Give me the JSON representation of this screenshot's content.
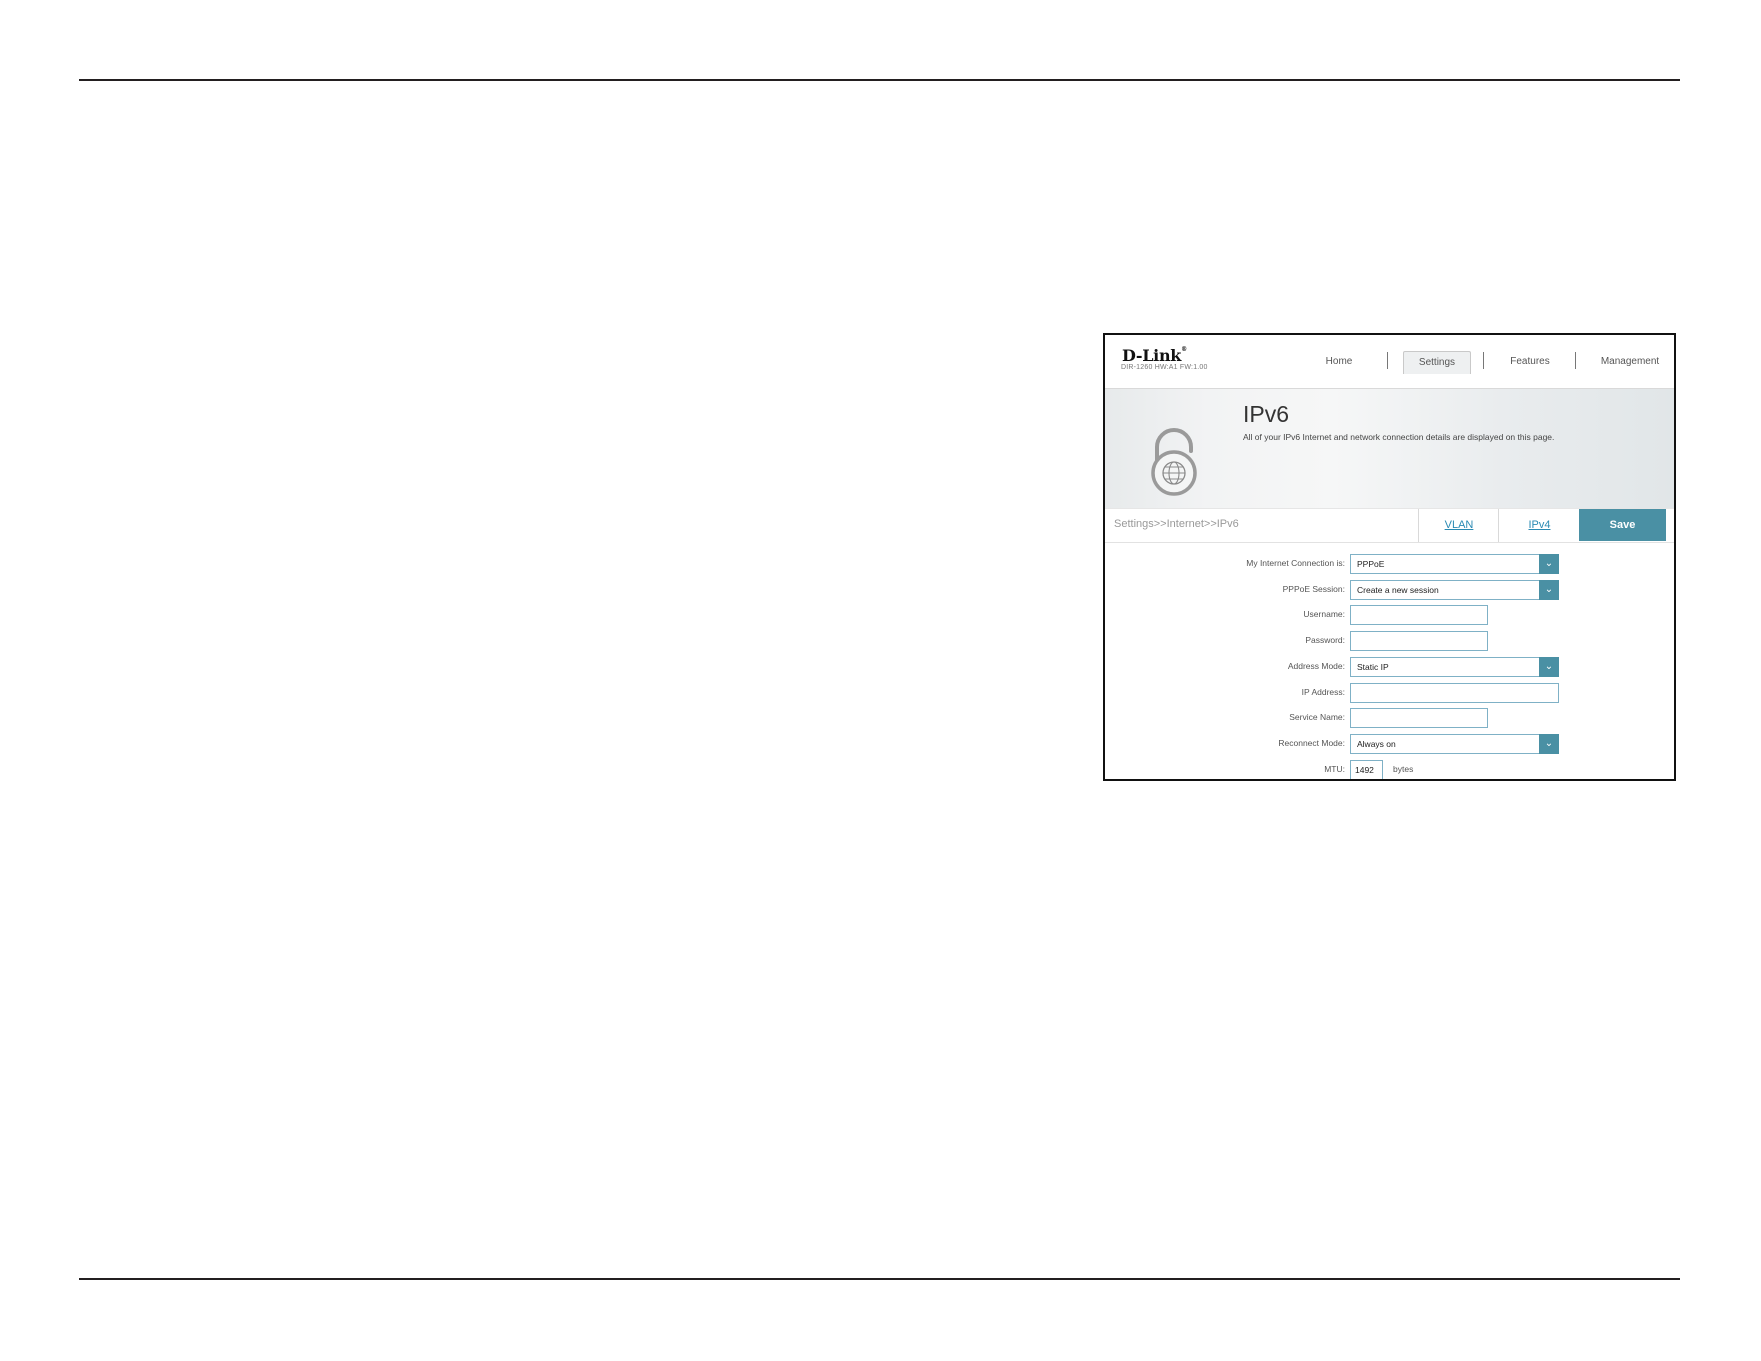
{
  "header": {
    "logo": "D-Link",
    "model_line": "DIR-1260 HW:A1 FW:1.00",
    "nav": {
      "home": "Home",
      "settings": "Settings",
      "features": "Features",
      "management": "Management"
    }
  },
  "hero": {
    "title": "IPv6",
    "description": "All of your IPv6 Internet and network connection details are displayed on this page.",
    "icon": "lock-globe-icon"
  },
  "tabbar": {
    "breadcrumb": "Settings>>Internet>>IPv6",
    "tab_vlan": "VLAN",
    "tab_ipv4": "IPv4",
    "save": "Save"
  },
  "form": {
    "connection": {
      "label": "My Internet Connection is:",
      "value": "PPPoE"
    },
    "pppoe_session": {
      "label": "PPPoE Session:",
      "value": "Create a new session"
    },
    "username": {
      "label": "Username:",
      "value": ""
    },
    "password": {
      "label": "Password:",
      "value": ""
    },
    "address_mode": {
      "label": "Address Mode:",
      "value": "Static IP"
    },
    "ip_address": {
      "label": "IP Address:",
      "value": ""
    },
    "service_name": {
      "label": "Service Name:",
      "value": ""
    },
    "reconnect_mode": {
      "label": "Reconnect Mode:",
      "value": "Always on"
    },
    "mtu": {
      "label": "MTU:",
      "value": "1492",
      "unit": "bytes"
    }
  },
  "colors": {
    "accent": "#4a90a4",
    "link": "#2a8ab3",
    "field_border": "#7fb1c6"
  }
}
